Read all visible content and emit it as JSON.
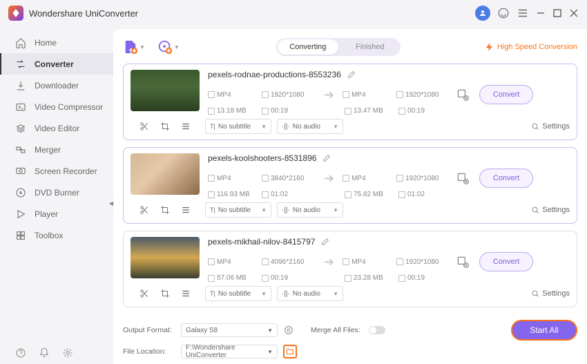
{
  "app_title": "Wondershare UniConverter",
  "sidebar": {
    "items": [
      {
        "label": "Home",
        "icon": "home"
      },
      {
        "label": "Converter",
        "icon": "converter",
        "active": true
      },
      {
        "label": "Downloader",
        "icon": "downloader"
      },
      {
        "label": "Video Compressor",
        "icon": "compressor"
      },
      {
        "label": "Video Editor",
        "icon": "editor"
      },
      {
        "label": "Merger",
        "icon": "merger"
      },
      {
        "label": "Screen Recorder",
        "icon": "recorder"
      },
      {
        "label": "DVD Burner",
        "icon": "dvd"
      },
      {
        "label": "Player",
        "icon": "player"
      },
      {
        "label": "Toolbox",
        "icon": "toolbox"
      }
    ]
  },
  "tabs": {
    "converting": "Converting",
    "finished": "Finished",
    "active": "converting"
  },
  "high_speed_label": "High Speed Conversion",
  "files": [
    {
      "name": "pexels-rodnae-productions-8553236",
      "thumb_css": "linear-gradient(to bottom, #3a5a2e 0%, #4a6a3a 40%, #2a4020 100%)",
      "src": {
        "format": "MP4",
        "res": "1920*1080",
        "size": "13.18 MB",
        "dur": "00:19"
      },
      "dst": {
        "format": "MP4",
        "res": "1920*1080",
        "size": "13.47 MB",
        "dur": "00:19"
      },
      "subtitle": "No subtitle",
      "audio": "No audio",
      "muted": false
    },
    {
      "name": "pexels-koolshooters-8531896",
      "thumb_css": "linear-gradient(135deg, #d4b896 0%, #e6c9a8 40%, #8a6a4a 100%)",
      "src": {
        "format": "MP4",
        "res": "3840*2160",
        "size": "116.93 MB",
        "dur": "01:02"
      },
      "dst": {
        "format": "MP4",
        "res": "1920*1080",
        "size": "75.82 MB",
        "dur": "01:02"
      },
      "subtitle": "No subtitle",
      "audio": "No audio",
      "muted": false
    },
    {
      "name": "pexels-mikhail-nilov-8415797",
      "thumb_css": "linear-gradient(to bottom, #4a5a6a 0%, #d4a850 50%, #3a4030 100%)",
      "src": {
        "format": "MP4",
        "res": "4096*2160",
        "size": "57.06 MB",
        "dur": "00:19"
      },
      "dst": {
        "format": "MP4",
        "res": "1920*1080",
        "size": "23.28 MB",
        "dur": "00:19"
      },
      "subtitle": "No subtitle",
      "audio": "No audio",
      "muted": true
    }
  ],
  "labels": {
    "convert": "Convert",
    "settings": "Settings",
    "output_format": "Output Format:",
    "file_location": "File Location:",
    "merge_all": "Merge All Files:",
    "start_all": "Start All"
  },
  "footer": {
    "output_format_value": "Galaxy S8",
    "file_location_value": "F:\\Wondershare UniConverter"
  }
}
